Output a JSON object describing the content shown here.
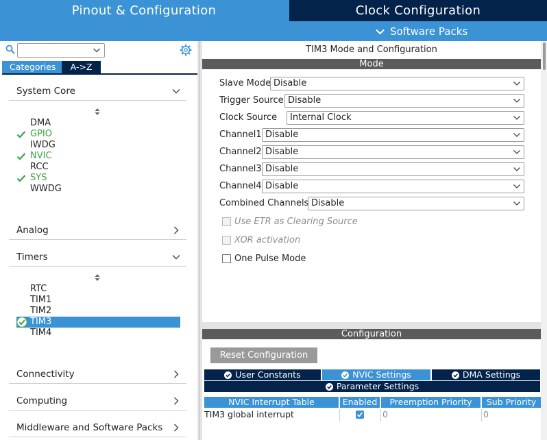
{
  "tabs": {
    "pinout": "Pinout & Configuration",
    "clock": "Clock Configuration",
    "software_packs": "Software Packs"
  },
  "left": {
    "categories_tab": "Categories",
    "az_tab": "A->Z",
    "sections": {
      "system_core": "System Core",
      "analog": "Analog",
      "timers": "Timers",
      "connectivity": "Connectivity",
      "computing": "Computing",
      "middleware": "Middleware and Software Packs"
    },
    "system_core_items": [
      {
        "label": "DMA",
        "ok": false
      },
      {
        "label": "GPIO",
        "ok": true
      },
      {
        "label": "IWDG",
        "ok": false
      },
      {
        "label": "NVIC",
        "ok": true
      },
      {
        "label": "RCC",
        "ok": false
      },
      {
        "label": "SYS",
        "ok": true
      },
      {
        "label": "WWDG",
        "ok": false
      }
    ],
    "timer_items": [
      {
        "label": "RTC",
        "ok": false
      },
      {
        "label": "TIM1",
        "ok": false
      },
      {
        "label": "TIM2",
        "ok": false
      },
      {
        "label": "TIM3",
        "ok": true,
        "selected": true
      },
      {
        "label": "TIM4",
        "ok": false
      }
    ]
  },
  "right": {
    "title": "TIM3 Mode and Configuration",
    "mode_bar": "Mode",
    "fields": {
      "slave_mode": {
        "label": "Slave Mode",
        "value": "Disable"
      },
      "trigger_source": {
        "label": "Trigger Source",
        "value": "Disable"
      },
      "clock_source": {
        "label": "Clock Source",
        "value": "Internal Clock"
      },
      "channel1": {
        "label": "Channel1",
        "value": "Disable"
      },
      "channel2": {
        "label": "Channel2",
        "value": "Disable"
      },
      "channel3": {
        "label": "Channel3",
        "value": "Disable"
      },
      "channel4": {
        "label": "Channel4",
        "value": "Disable"
      },
      "combined": {
        "label": "Combined Channels",
        "value": "Disable"
      }
    },
    "checks": {
      "use_etr": "Use ETR as Clearing Source",
      "xor": "XOR activation",
      "one_pulse": "One Pulse Mode"
    },
    "config_bar": "Configuration",
    "reset_button": "Reset Configuration",
    "cfg_tabs": {
      "user_constants": "User Constants",
      "nvic_settings": "NVIC Settings",
      "dma_settings": "DMA Settings",
      "parameter_settings": "Parameter Settings"
    },
    "table": {
      "headers": [
        "NVIC Interrupt Table",
        "Enabled",
        "Preemption Priority",
        "Sub Priority"
      ],
      "row": {
        "name": "TIM3 global interrupt",
        "enabled": true,
        "preemption": "0",
        "sub": "0"
      }
    }
  },
  "colors": {
    "accent": "#3b93d6",
    "dark_navy": "#03234b",
    "ok_green": "#37a442",
    "bar_gray": "#5b5b5b"
  }
}
